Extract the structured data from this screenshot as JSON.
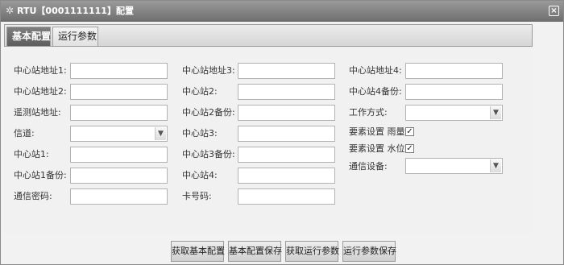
{
  "window": {
    "title": "RTU【0001111111】配置",
    "title_icon": "gear-icon",
    "close_label": "×"
  },
  "tabs": [
    {
      "label": "基本配置",
      "active": true
    },
    {
      "label": "运行参数",
      "active": false
    }
  ],
  "form": {
    "col1": [
      {
        "label": "中心站地址1:",
        "type": "text",
        "value": ""
      },
      {
        "label": "中心站地址2:",
        "type": "text",
        "value": ""
      },
      {
        "label": "遥测站地址:",
        "type": "text",
        "value": ""
      },
      {
        "label": "信道:",
        "type": "select",
        "value": ""
      },
      {
        "label": "中心站1:",
        "type": "text",
        "value": ""
      },
      {
        "label": "中心站1备份:",
        "type": "text",
        "value": ""
      },
      {
        "label": "通信密码:",
        "type": "text",
        "value": ""
      }
    ],
    "col2": [
      {
        "label": "中心站地址3:",
        "type": "text",
        "value": ""
      },
      {
        "label": "中心站2:",
        "type": "text",
        "value": ""
      },
      {
        "label": "中心站2备份:",
        "type": "text",
        "value": ""
      },
      {
        "label": "中心站3:",
        "type": "text",
        "value": ""
      },
      {
        "label": "中心站3备份:",
        "type": "text",
        "value": ""
      },
      {
        "label": "中心站4:",
        "type": "text",
        "value": ""
      },
      {
        "label": "卡号码:",
        "type": "text",
        "value": ""
      }
    ],
    "col3": [
      {
        "label": "中心站地址4:",
        "type": "text",
        "value": ""
      },
      {
        "label": "中心站4备份:",
        "type": "text",
        "value": ""
      },
      {
        "label": "工作方式:",
        "type": "select",
        "value": ""
      },
      {
        "label": "要素设置 雨量:",
        "type": "checkbox",
        "checked": true
      },
      {
        "label": "要素设置 水位:",
        "type": "checkbox",
        "checked": true
      },
      {
        "label": "通信设备:",
        "type": "select",
        "value": ""
      }
    ]
  },
  "buttons": [
    {
      "label": "获取基本配置"
    },
    {
      "label": "基本配置保存"
    },
    {
      "label": "获取运行参数"
    },
    {
      "label": "运行参数保存"
    }
  ],
  "colors": {
    "titlebar": "#7e7e7e",
    "active_tab": "#6a6a6a",
    "panel_bg": "#f1f1f1"
  }
}
